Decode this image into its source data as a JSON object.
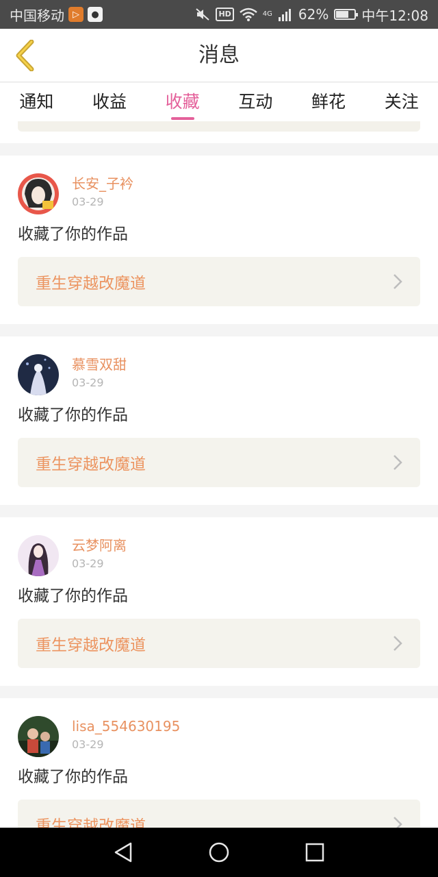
{
  "status_bar": {
    "carrier": "中国移动",
    "network": "4G",
    "battery": "62%",
    "battery_level": 0.62,
    "time": "中午12:08"
  },
  "header": {
    "title": "消息"
  },
  "tabs": [
    "通知",
    "收益",
    "收藏",
    "互动",
    "鲜花",
    "关注"
  ],
  "active_tab": "收藏",
  "notifications": [
    {
      "user": "长安_子衿",
      "date": "03-29",
      "action": "收藏了你的作品",
      "work": "重生穿越改魔道"
    },
    {
      "user": "慕雪双甜",
      "date": "03-29",
      "action": "收藏了你的作品",
      "work": "重生穿越改魔道"
    },
    {
      "user": "云梦阿离",
      "date": "03-29",
      "action": "收藏了你的作品",
      "work": "重生穿越改魔道"
    },
    {
      "user": "lisa_554630195",
      "date": "03-29",
      "action": "收藏了你的作品",
      "work": "重生穿越改魔道"
    }
  ],
  "colors": {
    "accent": "#e4609a",
    "username": "#e89160",
    "work_title": "#ec9460"
  }
}
